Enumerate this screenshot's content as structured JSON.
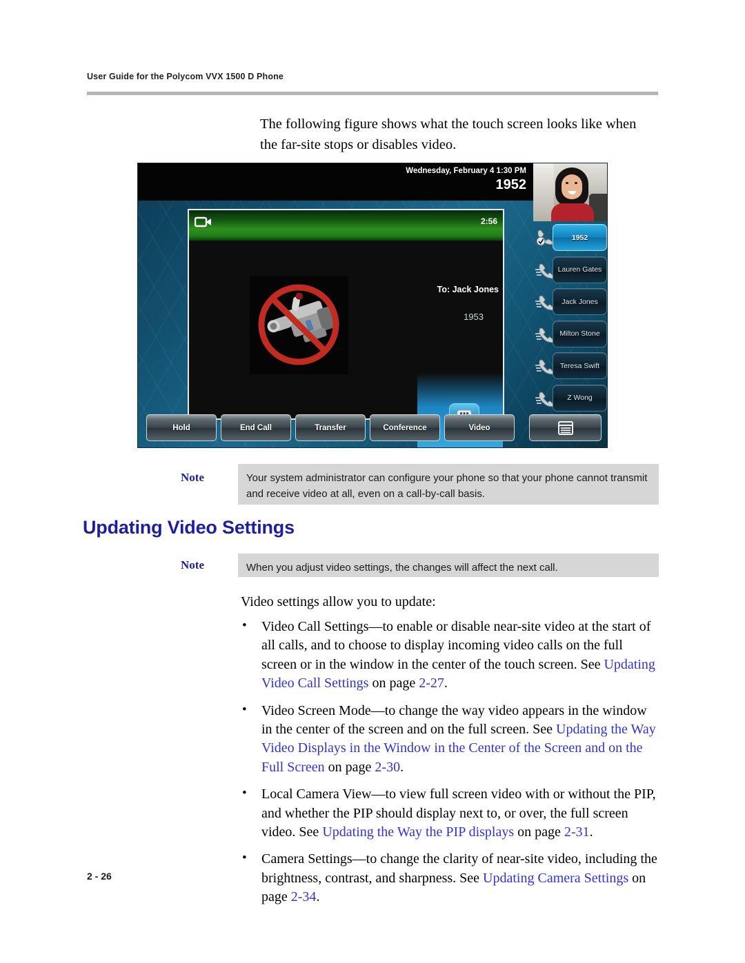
{
  "header": {
    "running_head": "User Guide for the Polycom VVX 1500 D Phone"
  },
  "intro": {
    "paragraph": "The following figure shows what the touch screen looks like when the far-site stops or disables video."
  },
  "phone_figure": {
    "status_bar": {
      "date_time": "Wednesday, February 4  1:30 PM",
      "extension": "1952"
    },
    "call_window": {
      "timer": "2:56",
      "to_label": "To: Jack Jones",
      "to_number": "1953",
      "video_state": "no-video-camera-icon"
    },
    "line_keys": [
      {
        "label": "1952",
        "active": true
      },
      {
        "label": "Lauren Gates",
        "active": false
      },
      {
        "label": "Jack Jones",
        "active": false
      },
      {
        "label": "Milton Stone",
        "active": false
      },
      {
        "label": "Teresa Swift",
        "active": false
      },
      {
        "label": "Z Wong",
        "active": false
      }
    ],
    "soft_keys": [
      {
        "label": "Hold"
      },
      {
        "label": "End Call"
      },
      {
        "label": "Transfer"
      },
      {
        "label": "Conference"
      },
      {
        "label": "Video"
      },
      {
        "label": ""
      }
    ],
    "colors": {
      "call_header_green": "#2f8f1e",
      "active_line_key_blue": "#1384bd",
      "screen_background_blue": "#12506f"
    }
  },
  "note_1": {
    "label": "Note",
    "text": "Your system administrator can configure your phone so that your phone cannot transmit and receive video at all, even on a call-by-call basis."
  },
  "heading": {
    "title": "Updating Video Settings"
  },
  "note_2": {
    "label": "Note",
    "text": "When you adjust video settings, the changes will affect the next call."
  },
  "body": {
    "lead_in": "Video settings allow you to update:",
    "bullets": [
      {
        "pre": "Video Call Settings—to enable or disable near-site video at the start of all calls, and to choose to display incoming video calls on the full screen or in the window in the center of the touch screen. See ",
        "link": "Updating Video Call Settings",
        "mid": " on page ",
        "page": "2-27",
        "post": "."
      },
      {
        "pre": "Video Screen Mode—to change the way video appears in the window in the center of the screen and on the full screen. See ",
        "link": "Updating the Way Video Displays in the Window in the Center of the Screen and on the Full Screen",
        "mid": " on page ",
        "page": "2-30",
        "post": "."
      },
      {
        "pre": "Local Camera View—to view full screen video with or without the PIP, and whether the PIP should display next to, or over, the full screen video. See ",
        "link": "Updating the Way the PIP displays",
        "mid": " on page ",
        "page": "2-31",
        "post": "."
      },
      {
        "pre": "Camera Settings—to change the clarity of near-site video, including the brightness, contrast, and sharpness. See ",
        "link": "Updating Camera Settings",
        "mid": " on page ",
        "page": "2-34",
        "post": "."
      }
    ],
    "bullet_marker": "•",
    "link_color": "#3333cc"
  },
  "footer": {
    "page_number": "2 - 26"
  }
}
